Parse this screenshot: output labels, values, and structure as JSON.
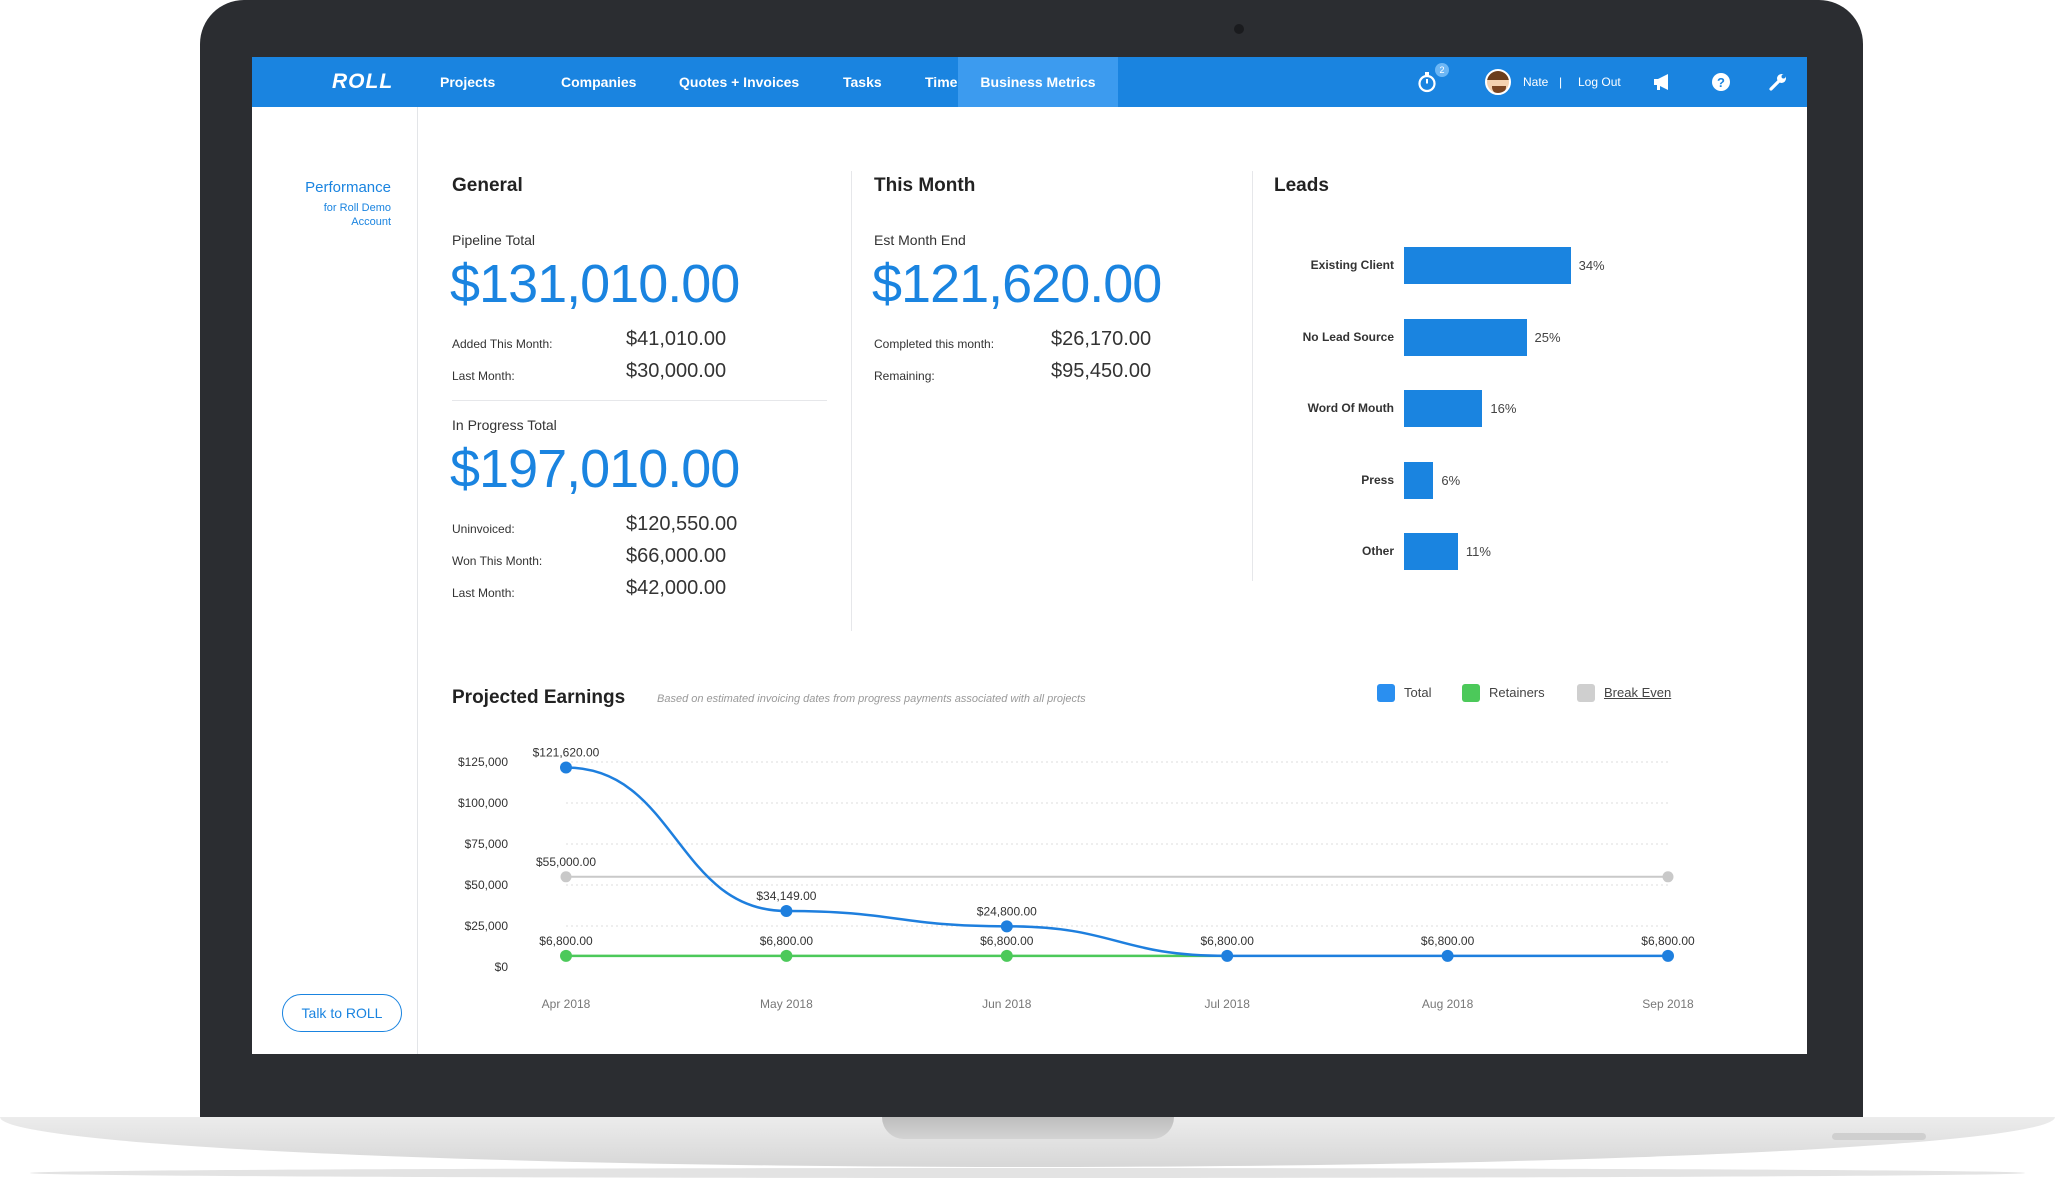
{
  "app": {
    "logo": "ROLL"
  },
  "nav": {
    "items": [
      "Projects",
      "Companies",
      "Quotes + Invoices",
      "Tasks",
      "Time",
      "Business Metrics"
    ],
    "active": "Business Metrics",
    "timer_badge": "2",
    "user_name": "Nate",
    "separator": "|",
    "logout": "Log Out",
    "icons": [
      "stopwatch-icon",
      "megaphone-icon",
      "help-icon",
      "wrench-icon"
    ]
  },
  "sidebar": {
    "title": "Performance",
    "subtitle": "for Roll Demo Account",
    "talk_button": "Talk to ROLL"
  },
  "general": {
    "heading": "General",
    "pipeline_label": "Pipeline Total",
    "pipeline_total": "$131,010.00",
    "added_label": "Added This Month:",
    "added_value": "$41,010.00",
    "last_month_label": "Last Month:",
    "last_month_value": "$30,000.00",
    "in_progress_label": "In Progress Total",
    "in_progress_total": "$197,010.00",
    "uninvoiced_label": "Uninvoiced:",
    "uninvoiced_value": "$120,550.00",
    "won_label": "Won This Month:",
    "won_value": "$66,000.00",
    "last_month2_label": "Last Month:",
    "last_month2_value": "$42,000.00"
  },
  "this_month": {
    "heading": "This Month",
    "est_label": "Est Month End",
    "est_value": "$121,620.00",
    "completed_label": "Completed this month:",
    "completed_value": "$26,170.00",
    "remaining_label": "Remaining:",
    "remaining_value": "$95,450.00"
  },
  "leads": {
    "heading": "Leads",
    "items": [
      {
        "name": "Existing Client",
        "label": "34%",
        "value": 34
      },
      {
        "name": "No Lead Source",
        "label": "25%",
        "value": 25
      },
      {
        "name": "Word Of Mouth",
        "label": "16%",
        "value": 16
      },
      {
        "name": "Press",
        "label": "6%",
        "value": 6
      },
      {
        "name": "Other",
        "label": "11%",
        "value": 11
      }
    ]
  },
  "projected": {
    "title": "Projected Earnings",
    "note": "Based on estimated invoicing dates from progress payments associated with all projects",
    "legend": [
      {
        "name": "Total",
        "color": "#2a8ff0"
      },
      {
        "name": "Retainers",
        "color": "#4cc95a"
      },
      {
        "name": "Break Even",
        "color": "#cfcfcf"
      }
    ]
  },
  "chart_data": {
    "type": "line",
    "title": "Projected Earnings",
    "categories": [
      "Apr 2018",
      "May 2018",
      "Jun 2018",
      "Jul 2018",
      "Aug 2018",
      "Sep 2018"
    ],
    "y_ticks": [
      "$125,000",
      "$100,000",
      "$75,000",
      "$50,000",
      "$25,000",
      "$0"
    ],
    "ylim": [
      0,
      125000
    ],
    "grid": true,
    "legend_position": "top-right",
    "series": [
      {
        "name": "Total",
        "color": "#1e7fde",
        "values": [
          121620,
          34149,
          24800,
          6800,
          6800,
          6800
        ],
        "labels": [
          "$121,620.00",
          "$34,149.00",
          "$24,800.00",
          "$6,800.00",
          "$6,800.00",
          "$6,800.00"
        ]
      },
      {
        "name": "Retainers",
        "color": "#4cc95a",
        "values": [
          6800,
          6800,
          6800
        ],
        "labels": [
          "$6,800.00",
          "$6,800.00",
          "$6,800.00"
        ]
      },
      {
        "name": "Break Even",
        "color": "#c9c9c9",
        "values": [
          55000,
          55000
        ],
        "labels": [
          "$55,000.00"
        ],
        "x_index": [
          0,
          5
        ]
      }
    ]
  }
}
